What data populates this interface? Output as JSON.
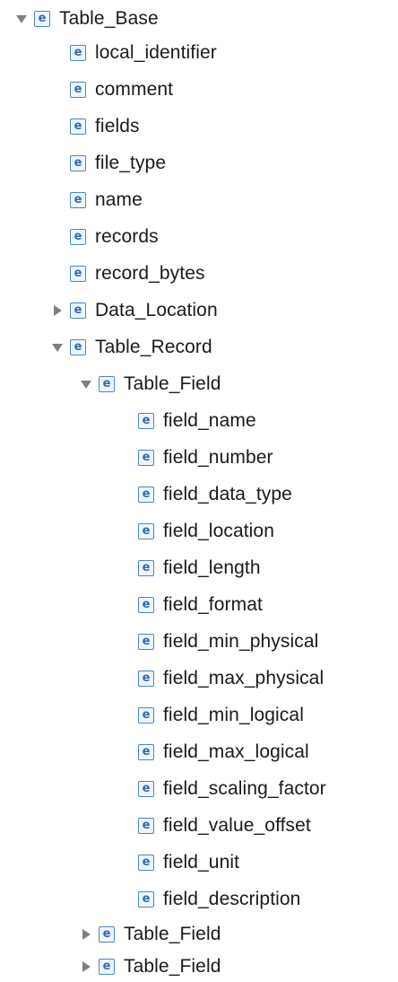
{
  "tree": {
    "icon_letter": "e",
    "nodes": [
      {
        "label": "Table_Base",
        "toggle": "expanded"
      },
      {
        "label": "local_identifier",
        "toggle": "none"
      },
      {
        "label": "comment",
        "toggle": "none"
      },
      {
        "label": "fields",
        "toggle": "none"
      },
      {
        "label": "file_type",
        "toggle": "none"
      },
      {
        "label": "name",
        "toggle": "none"
      },
      {
        "label": "records",
        "toggle": "none"
      },
      {
        "label": "record_bytes",
        "toggle": "none"
      },
      {
        "label": "Data_Location",
        "toggle": "collapsed"
      },
      {
        "label": "Table_Record",
        "toggle": "expanded"
      },
      {
        "label": "Table_Field",
        "toggle": "expanded"
      },
      {
        "label": "field_name",
        "toggle": "none"
      },
      {
        "label": "field_number",
        "toggle": "none"
      },
      {
        "label": "field_data_type",
        "toggle": "none"
      },
      {
        "label": "field_location",
        "toggle": "none"
      },
      {
        "label": "field_length",
        "toggle": "none"
      },
      {
        "label": "field_format",
        "toggle": "none"
      },
      {
        "label": "field_min_physical",
        "toggle": "none"
      },
      {
        "label": "field_max_physical",
        "toggle": "none"
      },
      {
        "label": "field_min_logical",
        "toggle": "none"
      },
      {
        "label": "field_max_logical",
        "toggle": "none"
      },
      {
        "label": "field_scaling_factor",
        "toggle": "none"
      },
      {
        "label": "field_value_offset",
        "toggle": "none"
      },
      {
        "label": "field_unit",
        "toggle": "none"
      },
      {
        "label": "field_description",
        "toggle": "none"
      },
      {
        "label": "Table_Field",
        "toggle": "collapsed"
      },
      {
        "label": "Table_Field",
        "toggle": "collapsed"
      }
    ]
  },
  "colors": {
    "icon_border": "#4a86c8",
    "icon_letter": "#2d6bb3",
    "disclosure_triangle": "#7f7f7f",
    "text": "#1a1a1a"
  }
}
